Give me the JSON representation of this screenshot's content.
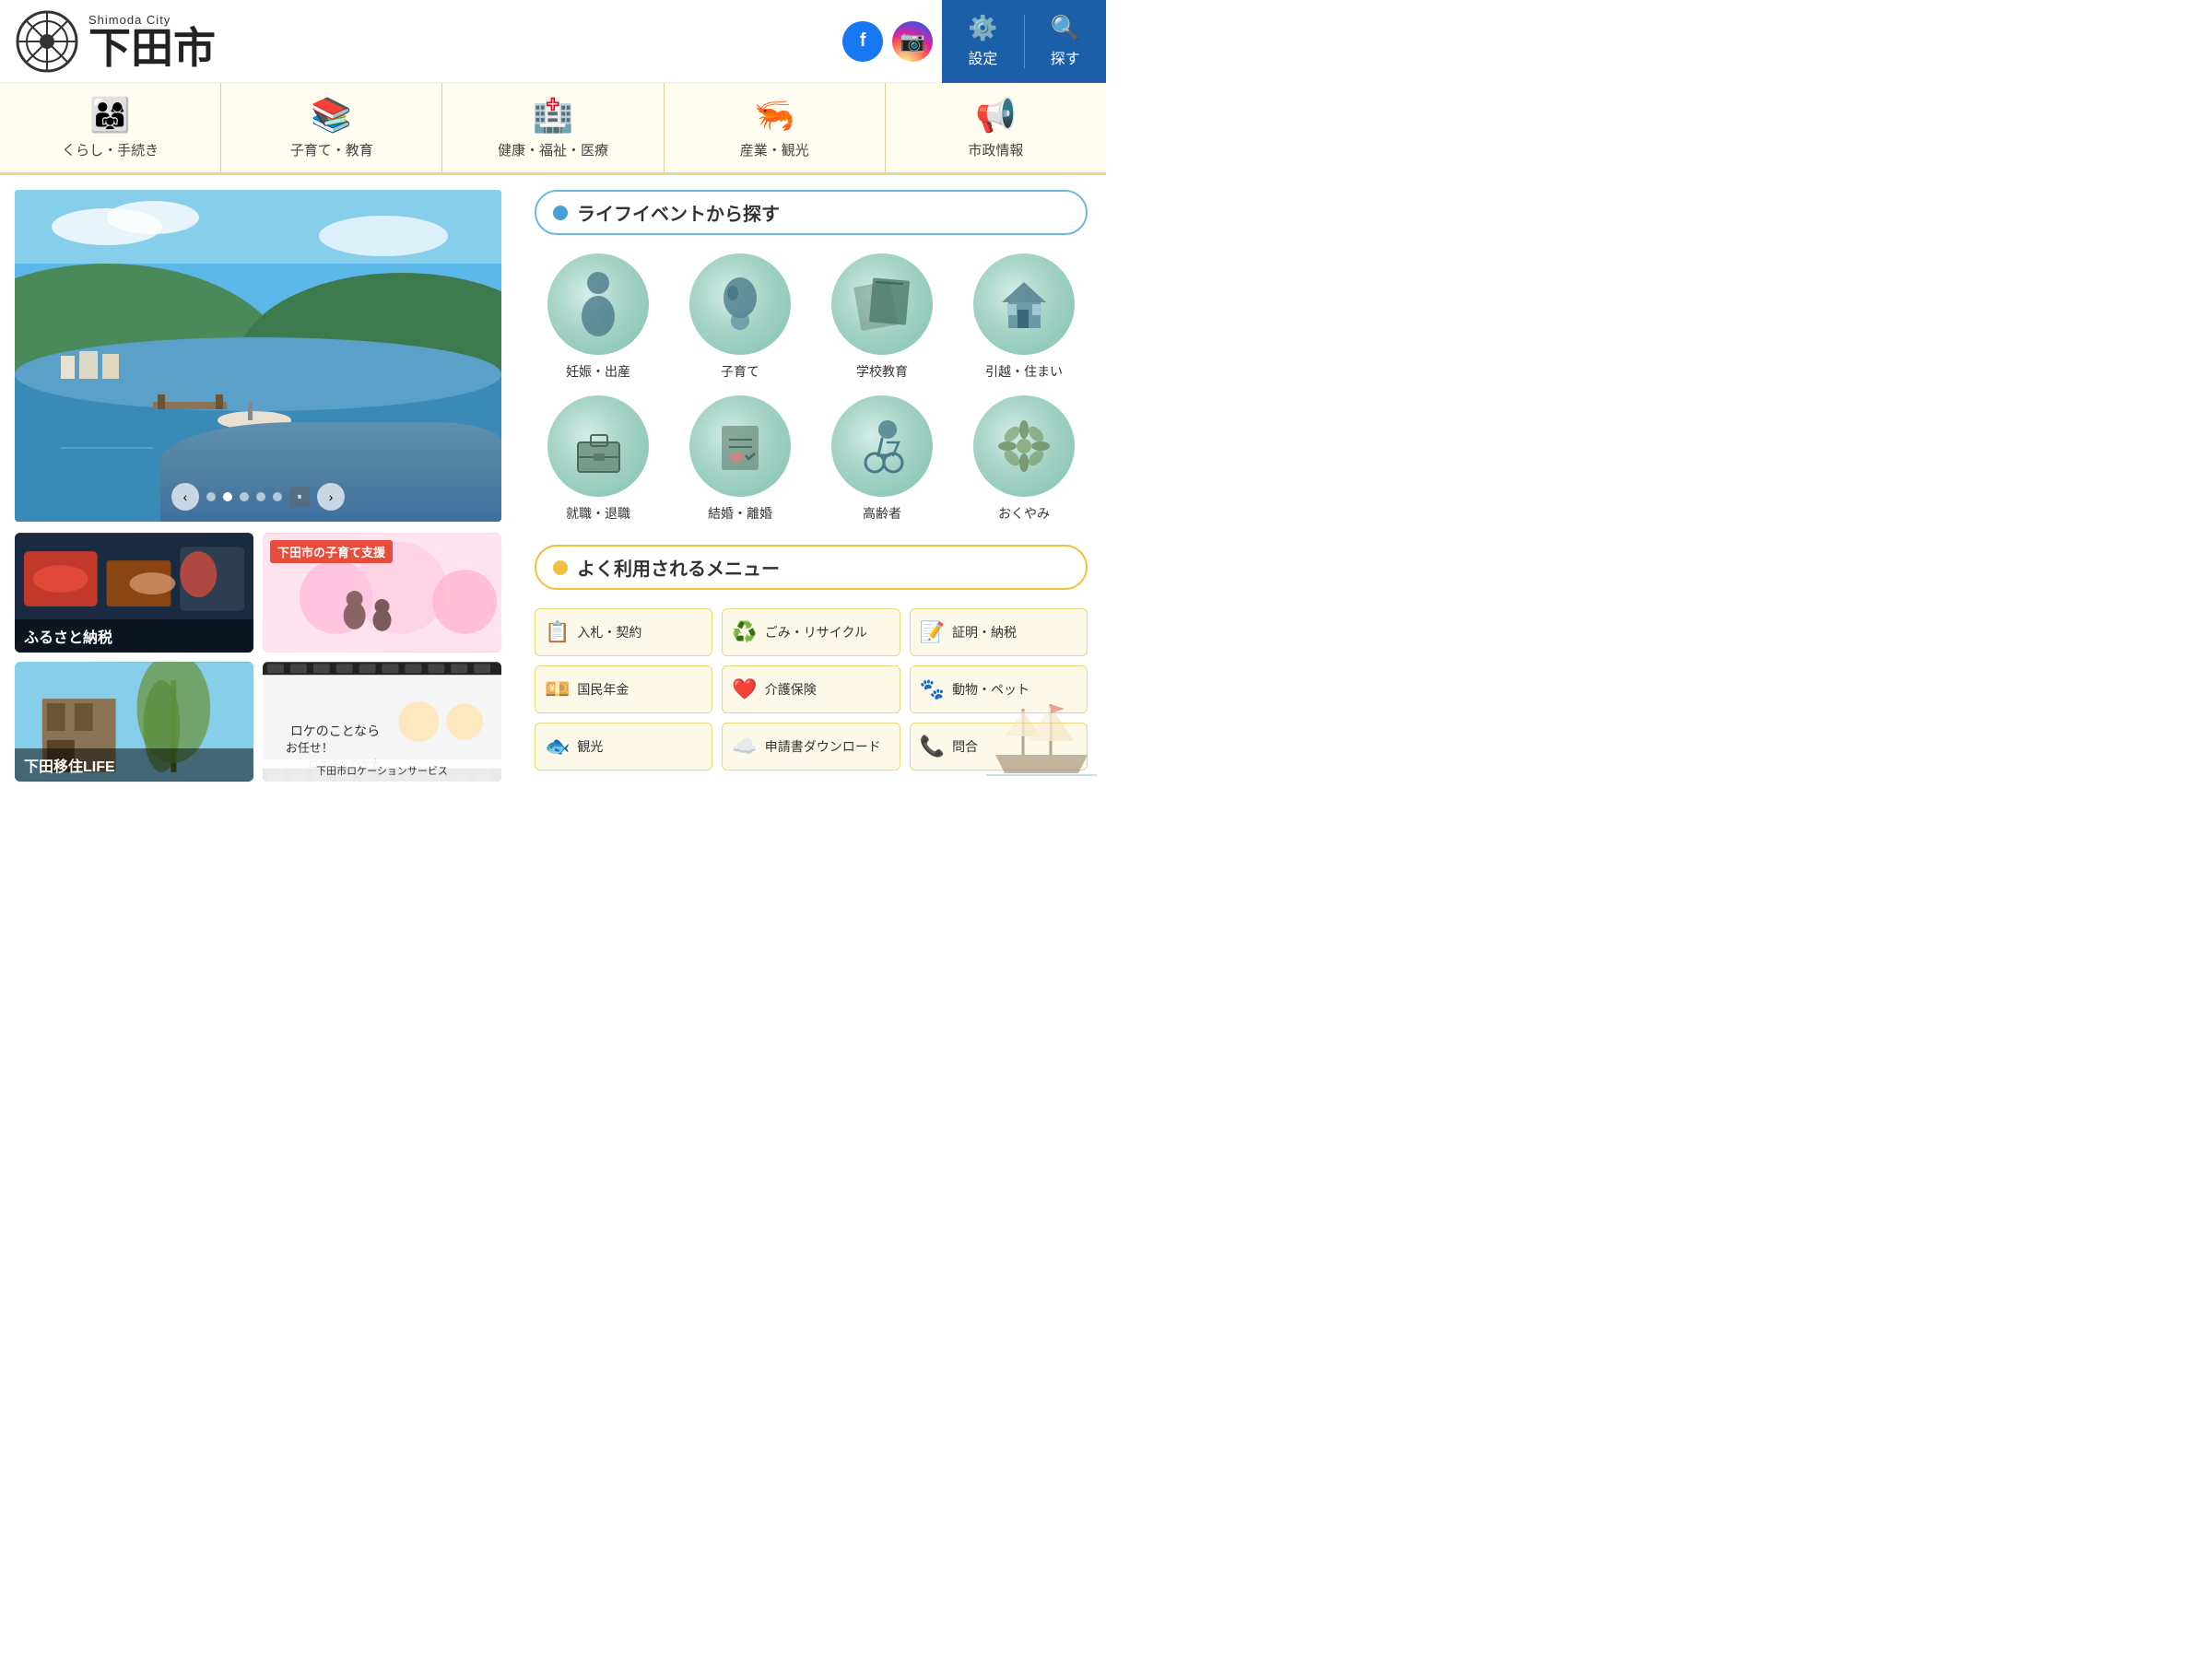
{
  "header": {
    "logo_small": "Shimoda City",
    "logo_kanji": "下田市",
    "settings_label": "設定",
    "search_label": "探す",
    "facebook_title": "Facebook",
    "instagram_title": "Instagram"
  },
  "nav": {
    "items": [
      {
        "id": "life",
        "icon": "👨‍👩‍👧",
        "label": "くらし・手続き"
      },
      {
        "id": "childcare",
        "icon": "📚",
        "label": "子育て・教育"
      },
      {
        "id": "health",
        "icon": "🏥",
        "label": "健康・福祉・医療"
      },
      {
        "id": "industry",
        "icon": "🦐",
        "label": "産業・観光"
      },
      {
        "id": "city",
        "icon": "📢",
        "label": "市政情報"
      }
    ]
  },
  "slideshow": {
    "dots": 5,
    "prev_label": "‹",
    "next_label": "›"
  },
  "thumbnails": [
    {
      "id": "furusato",
      "label": "ふるさと納税",
      "type": "food"
    },
    {
      "id": "kosodate",
      "label_top": "下田市の子育て支援",
      "type": "flower"
    },
    {
      "id": "ijuu",
      "label": "下田移住LIFE",
      "type": "nature"
    },
    {
      "id": "location",
      "label": "",
      "type": "film"
    }
  ],
  "life_events": {
    "section_title": "ライフイベントから探す",
    "items": [
      {
        "id": "pregnancy",
        "icon": "🤰",
        "label": "妊娠・出産"
      },
      {
        "id": "childcare2",
        "icon": "🍼",
        "label": "子育て"
      },
      {
        "id": "education",
        "icon": "📐",
        "label": "学校教育"
      },
      {
        "id": "moving",
        "icon": "🏠",
        "label": "引越・住まい"
      },
      {
        "id": "job",
        "icon": "💼",
        "label": "就職・退職"
      },
      {
        "id": "marriage",
        "icon": "📋",
        "label": "結婚・離婚"
      },
      {
        "id": "elderly",
        "icon": "♿",
        "label": "高齢者"
      },
      {
        "id": "funeral",
        "icon": "🌸",
        "label": "おくやみ"
      }
    ]
  },
  "frequently_used": {
    "section_title": "よく利用されるメニュー",
    "items": [
      {
        "id": "tender",
        "icon": "📋",
        "label": "入札・契約"
      },
      {
        "id": "garbage",
        "icon": "♻️",
        "label": "ごみ・リサイクル"
      },
      {
        "id": "certificate",
        "icon": "📝",
        "label": "証明・納税"
      },
      {
        "id": "pension",
        "icon": "💴",
        "label": "国民年金"
      },
      {
        "id": "nursing",
        "icon": "❤️",
        "label": "介護保険"
      },
      {
        "id": "animal",
        "icon": "🐾",
        "label": "動物・ペット"
      },
      {
        "id": "tourism",
        "icon": "🐟",
        "label": "観光"
      },
      {
        "id": "download",
        "icon": "☁️",
        "label": "申請書ダウンロード"
      },
      {
        "id": "inquiry",
        "icon": "📞",
        "label": "問合"
      }
    ]
  }
}
